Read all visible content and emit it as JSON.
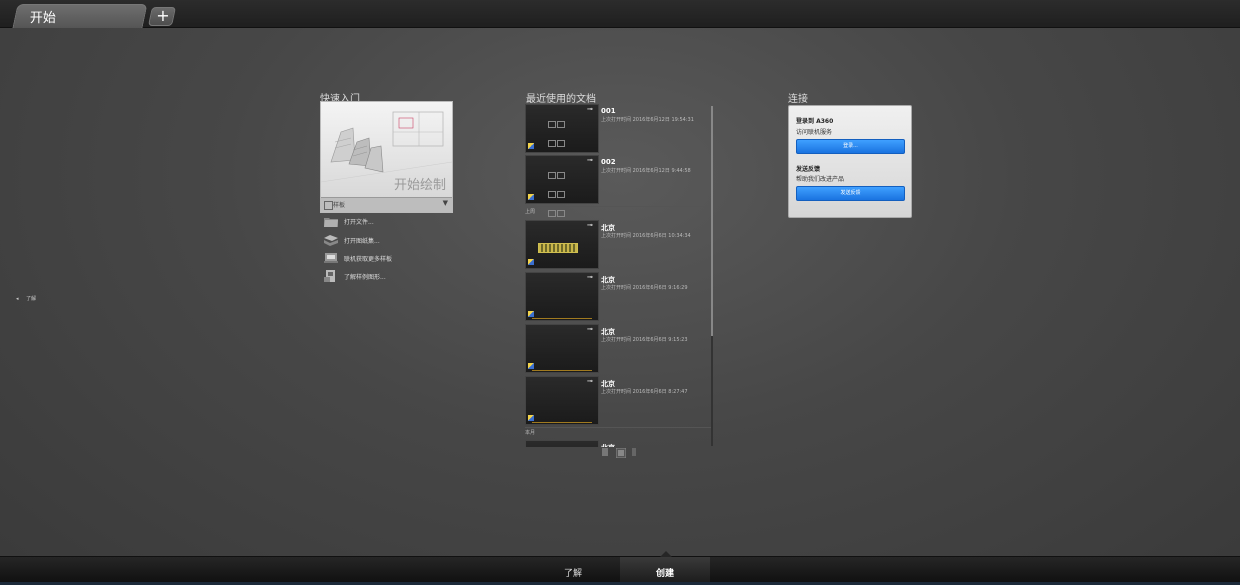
{
  "tabs": {
    "start_label": "开始",
    "add_label": "+"
  },
  "quick_start": {
    "title": "快速入门",
    "card_text": "开始绘制",
    "template_label": "样板",
    "links": [
      "打开文件...",
      "打开图纸集...",
      "联机获取更多样板",
      "了解样例图形..."
    ]
  },
  "recent": {
    "title": "最近使用的文档",
    "pin_glyph": "⊸",
    "groups": {
      "last_week": "上周",
      "this_month": "本月"
    },
    "docs": [
      {
        "name": "001",
        "meta": "上次打开时间 2016年6月12日 19:54:31"
      },
      {
        "name": "002",
        "meta": "上次打开时间 2016年6月12日 9:44:58"
      },
      {
        "name": "北京",
        "meta": "上次打开时间 2016年6月6日 10:34:34"
      },
      {
        "name": "北京",
        "meta": "上次打开时间 2016年6月6日 9:16:29"
      },
      {
        "name": "北京",
        "meta": "上次打开时间 2016年6月6日 9:15:23"
      },
      {
        "name": "北京",
        "meta": "上次打开时间 2016年6月6日 8:27:47"
      },
      {
        "name": "北京",
        "meta": ""
      }
    ]
  },
  "connect": {
    "title": "连接",
    "login_heading": "登录到 A360",
    "login_sub": "访问联机服务",
    "login_button": "登录...",
    "feedback_heading": "发送反馈",
    "feedback_sub": "帮助我们改进产品",
    "feedback_button": "发送反馈"
  },
  "side": {
    "learn_arrow": "◂",
    "learn_label": "了解"
  },
  "bottom": {
    "learn_tab": "了解",
    "create_tab": "创建"
  },
  "colors": {
    "accent_blue": "#1a73e0",
    "background": "#474747"
  }
}
